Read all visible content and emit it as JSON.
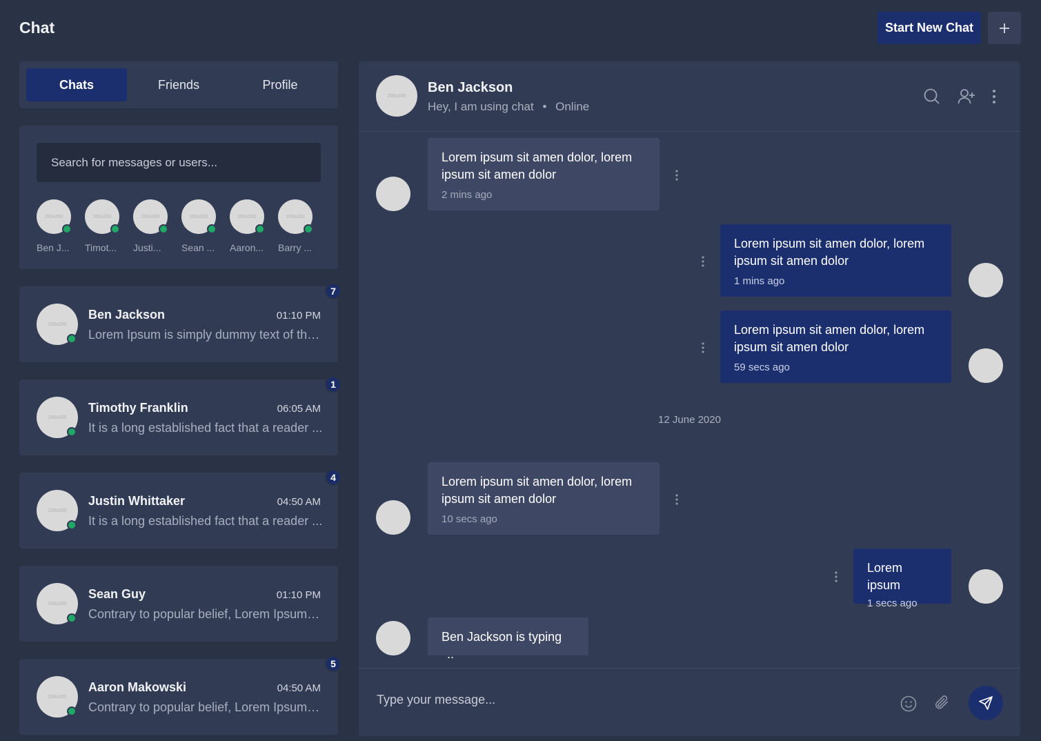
{
  "app_title": "Chat",
  "top_actions": {
    "new_chat_label": "Start New Chat",
    "plus_icon": "plus-icon"
  },
  "tabs": [
    {
      "label": "Chats",
      "active": true
    },
    {
      "label": "Friends",
      "active": false
    },
    {
      "label": "Profile",
      "active": false
    }
  ],
  "search": {
    "placeholder": "Search for messages or users..."
  },
  "online_users": [
    {
      "name": "Ben J...",
      "avatar_text": "200x200"
    },
    {
      "name": "Timot...",
      "avatar_text": "200x200"
    },
    {
      "name": "Justi...",
      "avatar_text": "200x200"
    },
    {
      "name": "Sean ...",
      "avatar_text": "200x200"
    },
    {
      "name": "Aaron...",
      "avatar_text": "200x200"
    },
    {
      "name": "Barry ...",
      "avatar_text": "200x200"
    }
  ],
  "conversations": [
    {
      "name": "Ben Jackson",
      "time": "01:10 PM",
      "preview": "Lorem Ipsum is simply dummy text of the...",
      "unread": "7",
      "avatar_text": "200x200"
    },
    {
      "name": "Timothy Franklin",
      "time": "06:05 AM",
      "preview": "It is a long established fact that a reader ...",
      "unread": "1",
      "avatar_text": "200x200"
    },
    {
      "name": "Justin Whittaker",
      "time": "04:50 AM",
      "preview": "It is a long established fact that a reader ...",
      "unread": "4",
      "avatar_text": "200x200"
    },
    {
      "name": "Sean Guy",
      "time": "01:10 PM",
      "preview": "Contrary to popular belief, Lorem Ipsum is...",
      "unread": "",
      "avatar_text": "200x200"
    },
    {
      "name": "Aaron Makowski",
      "time": "04:50 AM",
      "preview": "Contrary to popular belief, Lorem Ipsum is...",
      "unread": "5",
      "avatar_text": "200x200"
    }
  ],
  "chat_header": {
    "name": "Ben Jackson",
    "status": "Hey, I am using chat",
    "presence": "Online",
    "avatar_text": "200x200",
    "icons": [
      "search-icon",
      "add-user-icon",
      "more-vertical-icon"
    ]
  },
  "messages": [
    {
      "direction": "in",
      "text": "Lorem ipsum sit amen dolor, lorem ipsum sit amen dolor",
      "time": "2 mins ago"
    },
    {
      "direction": "out",
      "text": "Lorem ipsum sit amen dolor, lorem ipsum sit amen dolor",
      "time": "1 mins ago"
    },
    {
      "direction": "out",
      "text": "Lorem ipsum sit amen dolor, lorem ipsum sit amen dolor",
      "time": "59 secs ago"
    },
    {
      "direction": "in",
      "text": "Lorem ipsum sit amen dolor, lorem ipsum sit amen dolor",
      "time": "10 secs ago"
    },
    {
      "direction": "out",
      "text": "Lorem ipsum",
      "time": "1 secs ago"
    }
  ],
  "date_separator": "12 June 2020",
  "typing": {
    "text": "Ben Jackson is typing",
    "dots": ".."
  },
  "composer": {
    "placeholder": "Type your message...",
    "icons": [
      "emoji-icon",
      "paperclip-icon",
      "send-icon"
    ]
  },
  "colors": {
    "background": "#2a3245",
    "panel": "#323b54",
    "accent": "#1b2f6e",
    "incoming_bubble": "#3e4763",
    "online": "#1fa866"
  }
}
